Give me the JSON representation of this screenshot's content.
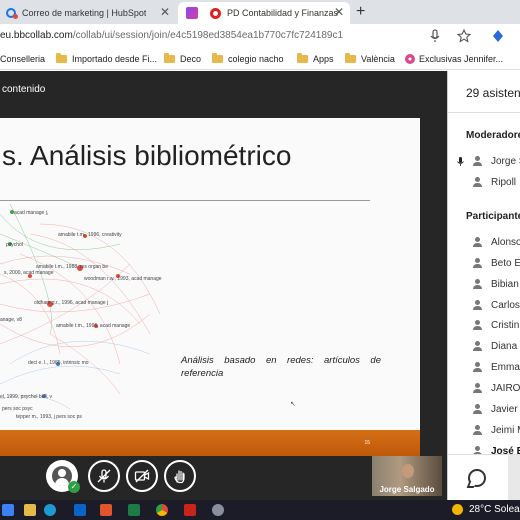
{
  "browser": {
    "tabs": [
      {
        "title": "Correo de marketing | HubSpot",
        "active": false
      },
      {
        "title": "PD Contabilidad y Finanzas",
        "active": true
      }
    ],
    "new_tab_symbol": "+",
    "close_symbol": "✕",
    "url_host": "eu.bbcollab.com",
    "url_path": "/collab/ui/session/join/e4c5198ed3854ea1b770c7fc724189c1"
  },
  "bookmarks": [
    {
      "label": "Conselleria",
      "icon": "flower-icon"
    },
    {
      "label": "Importado desde Fi...",
      "icon": "folder-icon"
    },
    {
      "label": "Deco",
      "icon": "folder-icon"
    },
    {
      "label": "colegio nacho",
      "icon": "folder-icon"
    },
    {
      "label": "Apps",
      "icon": "folder-icon"
    },
    {
      "label": "València",
      "icon": "folder-icon"
    },
    {
      "label": "Exclusivas Jennifer...",
      "icon": "flower-icon"
    }
  ],
  "session": {
    "content_label": "contenido"
  },
  "slide": {
    "title": "s. Análisis bibliométrico",
    "analysis_text": "Análisis basado en redes: artículos de referencia",
    "page_number": "15",
    "network_labels": [
      "acad manage j,",
      "amabile t.m., 1996, creativity",
      "psychol",
      "amabile t.m., 1988, res organ be",
      "s, 2000, acad manage",
      "woodman r.w., 1993, acad manage",
      "oldham g.r., 1996, acad manage j",
      "anage, v8",
      "amabile t.m., 1996, acad manage",
      "deci e. l., 1985, intrinsic mo",
      "el, 1999, psychol bull, v",
      "pers soc psyc",
      "tepper m., 1993, j pers soc ps"
    ]
  },
  "presenter": {
    "name": "Jorge Salgado"
  },
  "panel": {
    "attendees_count": "29 asisten",
    "moderators_title": "Moderadores",
    "moderators": [
      {
        "name": "Jorge S",
        "speaking": true
      },
      {
        "name": "Ripoll",
        "speaking": false
      }
    ],
    "participants_title": "Participantes",
    "participants": [
      {
        "name": "Alonso",
        "bold": false
      },
      {
        "name": "Beto E",
        "bold": false
      },
      {
        "name": "Bibian",
        "bold": false
      },
      {
        "name": "Carlos",
        "bold": false
      },
      {
        "name": "Cristin",
        "bold": false
      },
      {
        "name": "Diana",
        "bold": false
      },
      {
        "name": "Emma",
        "bold": false
      },
      {
        "name": "JAIRO",
        "bold": false
      },
      {
        "name": "Javier",
        "bold": false
      },
      {
        "name": "Jeimi M",
        "bold": false
      },
      {
        "name": "José B",
        "bold": true
      }
    ]
  },
  "taskbar": {
    "weather": "28°C Solea"
  },
  "colors": {
    "stage_bg": "#262626",
    "slide_footer": "#d56f16",
    "status_ok": "#2ea043"
  }
}
